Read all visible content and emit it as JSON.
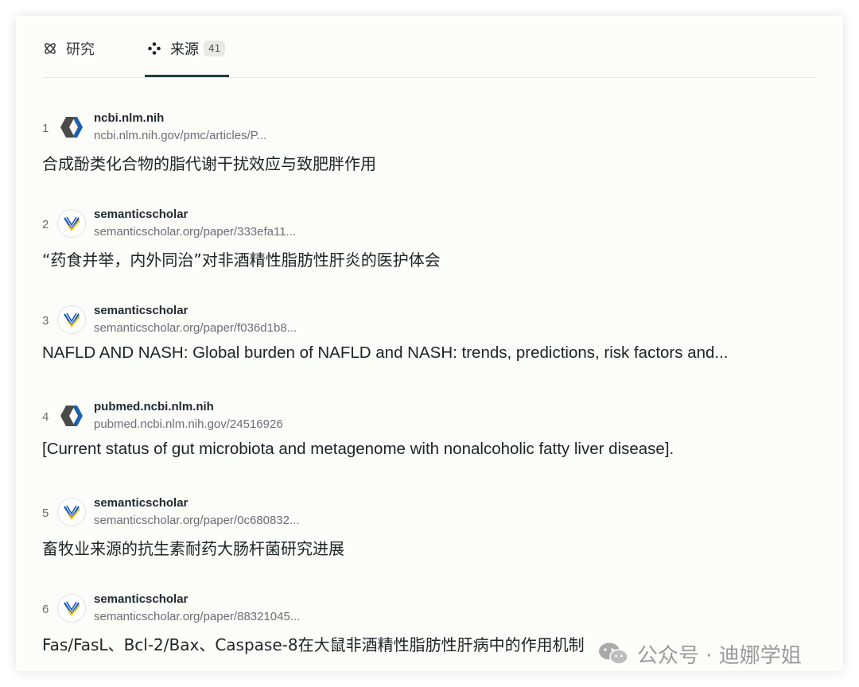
{
  "tabs": [
    {
      "label": "研究",
      "icon": "atom-icon"
    },
    {
      "label": "来源",
      "icon": "sources-icon",
      "count": "41",
      "active": true
    }
  ],
  "sources": [
    {
      "index": "1",
      "domain": "ncbi.nlm.nih",
      "url": "ncbi.nlm.nih.gov/pmc/articles/P...",
      "title": "合成酚类化合物的脂代谢干扰效应与致肥胖作用",
      "favicon": "ncbi-icon"
    },
    {
      "index": "2",
      "domain": "semanticscholar",
      "url": "semanticscholar.org/paper/333efa11...",
      "title": "“药食并举，内外同治”对非酒精性脂肪性肝炎的医护体会",
      "favicon": "semanticscholar-icon"
    },
    {
      "index": "3",
      "domain": "semanticscholar",
      "url": "semanticscholar.org/paper/f036d1b8...",
      "title": "NAFLD AND NASH: Global burden of NAFLD and NASH: trends, predictions, risk factors and...",
      "favicon": "semanticscholar-icon"
    },
    {
      "index": "4",
      "domain": "pubmed.ncbi.nlm.nih",
      "url": "pubmed.ncbi.nlm.nih.gov/24516926",
      "title": "[Current status of gut microbiota and metagenome with nonalcoholic fatty liver disease].",
      "favicon": "ncbi-icon"
    },
    {
      "index": "5",
      "domain": "semanticscholar",
      "url": "semanticscholar.org/paper/0c680832...",
      "title": "畜牧业来源的抗生素耐药大肠杆菌研究进展",
      "favicon": "semanticscholar-icon"
    },
    {
      "index": "6",
      "domain": "semanticscholar",
      "url": "semanticscholar.org/paper/88321045...",
      "title": "Fas/FasL、Bcl-2/Bax、Caspase-8在大鼠非酒精性脂肪性肝病中的作用机制",
      "favicon": "semanticscholar-icon"
    }
  ],
  "watermark": {
    "text": "公众号 · 迪娜学姐",
    "icon": "wechat-icon"
  },
  "colors": {
    "accent": "#1f3c44",
    "ncbi_dark": "#4a4a4a",
    "ncbi_blue": "#1f5fae",
    "ss_blue": "#1857b6",
    "ss_yellow": "#f0c419"
  }
}
